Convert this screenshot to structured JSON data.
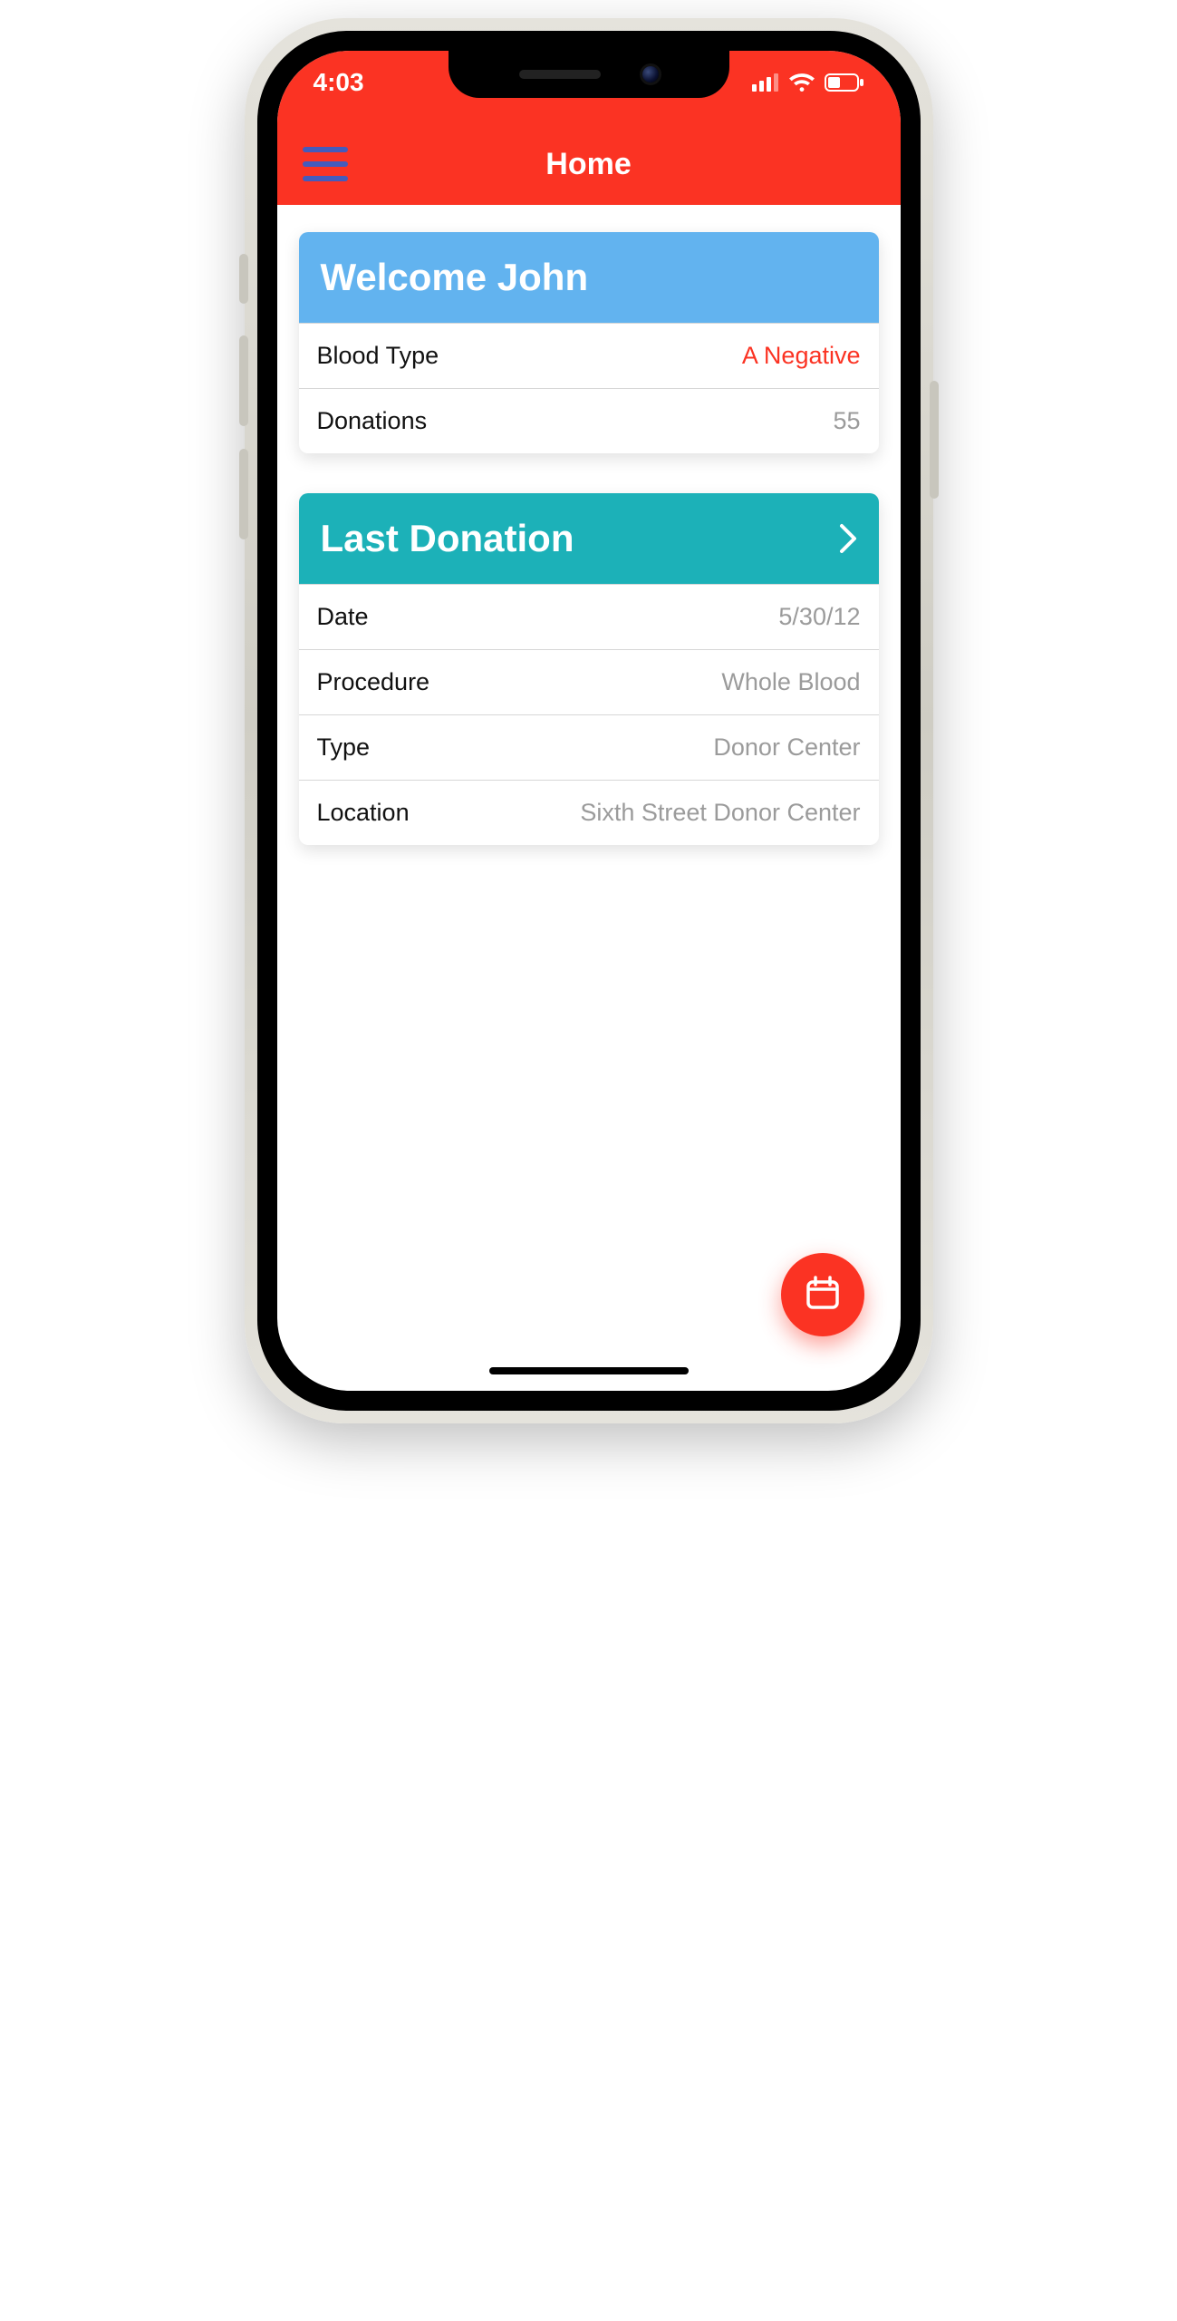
{
  "status": {
    "time": "4:03"
  },
  "nav": {
    "title": "Home"
  },
  "welcome_card": {
    "title": "Welcome John",
    "rows": {
      "blood_type": {
        "label": "Blood Type",
        "value": "A Negative"
      },
      "donations": {
        "label": "Donations",
        "value": "55"
      }
    }
  },
  "last_donation_card": {
    "title": "Last Donation",
    "rows": {
      "date": {
        "label": "Date",
        "value": "5/30/12"
      },
      "procedure": {
        "label": "Procedure",
        "value": "Whole Blood"
      },
      "type": {
        "label": "Type",
        "value": "Donor Center"
      },
      "location": {
        "label": "Location",
        "value": "Sixth Street Donor Center"
      }
    }
  },
  "colors": {
    "primary": "#fb3323",
    "card_blue": "#62b3ef",
    "card_teal": "#1cb1b8"
  }
}
